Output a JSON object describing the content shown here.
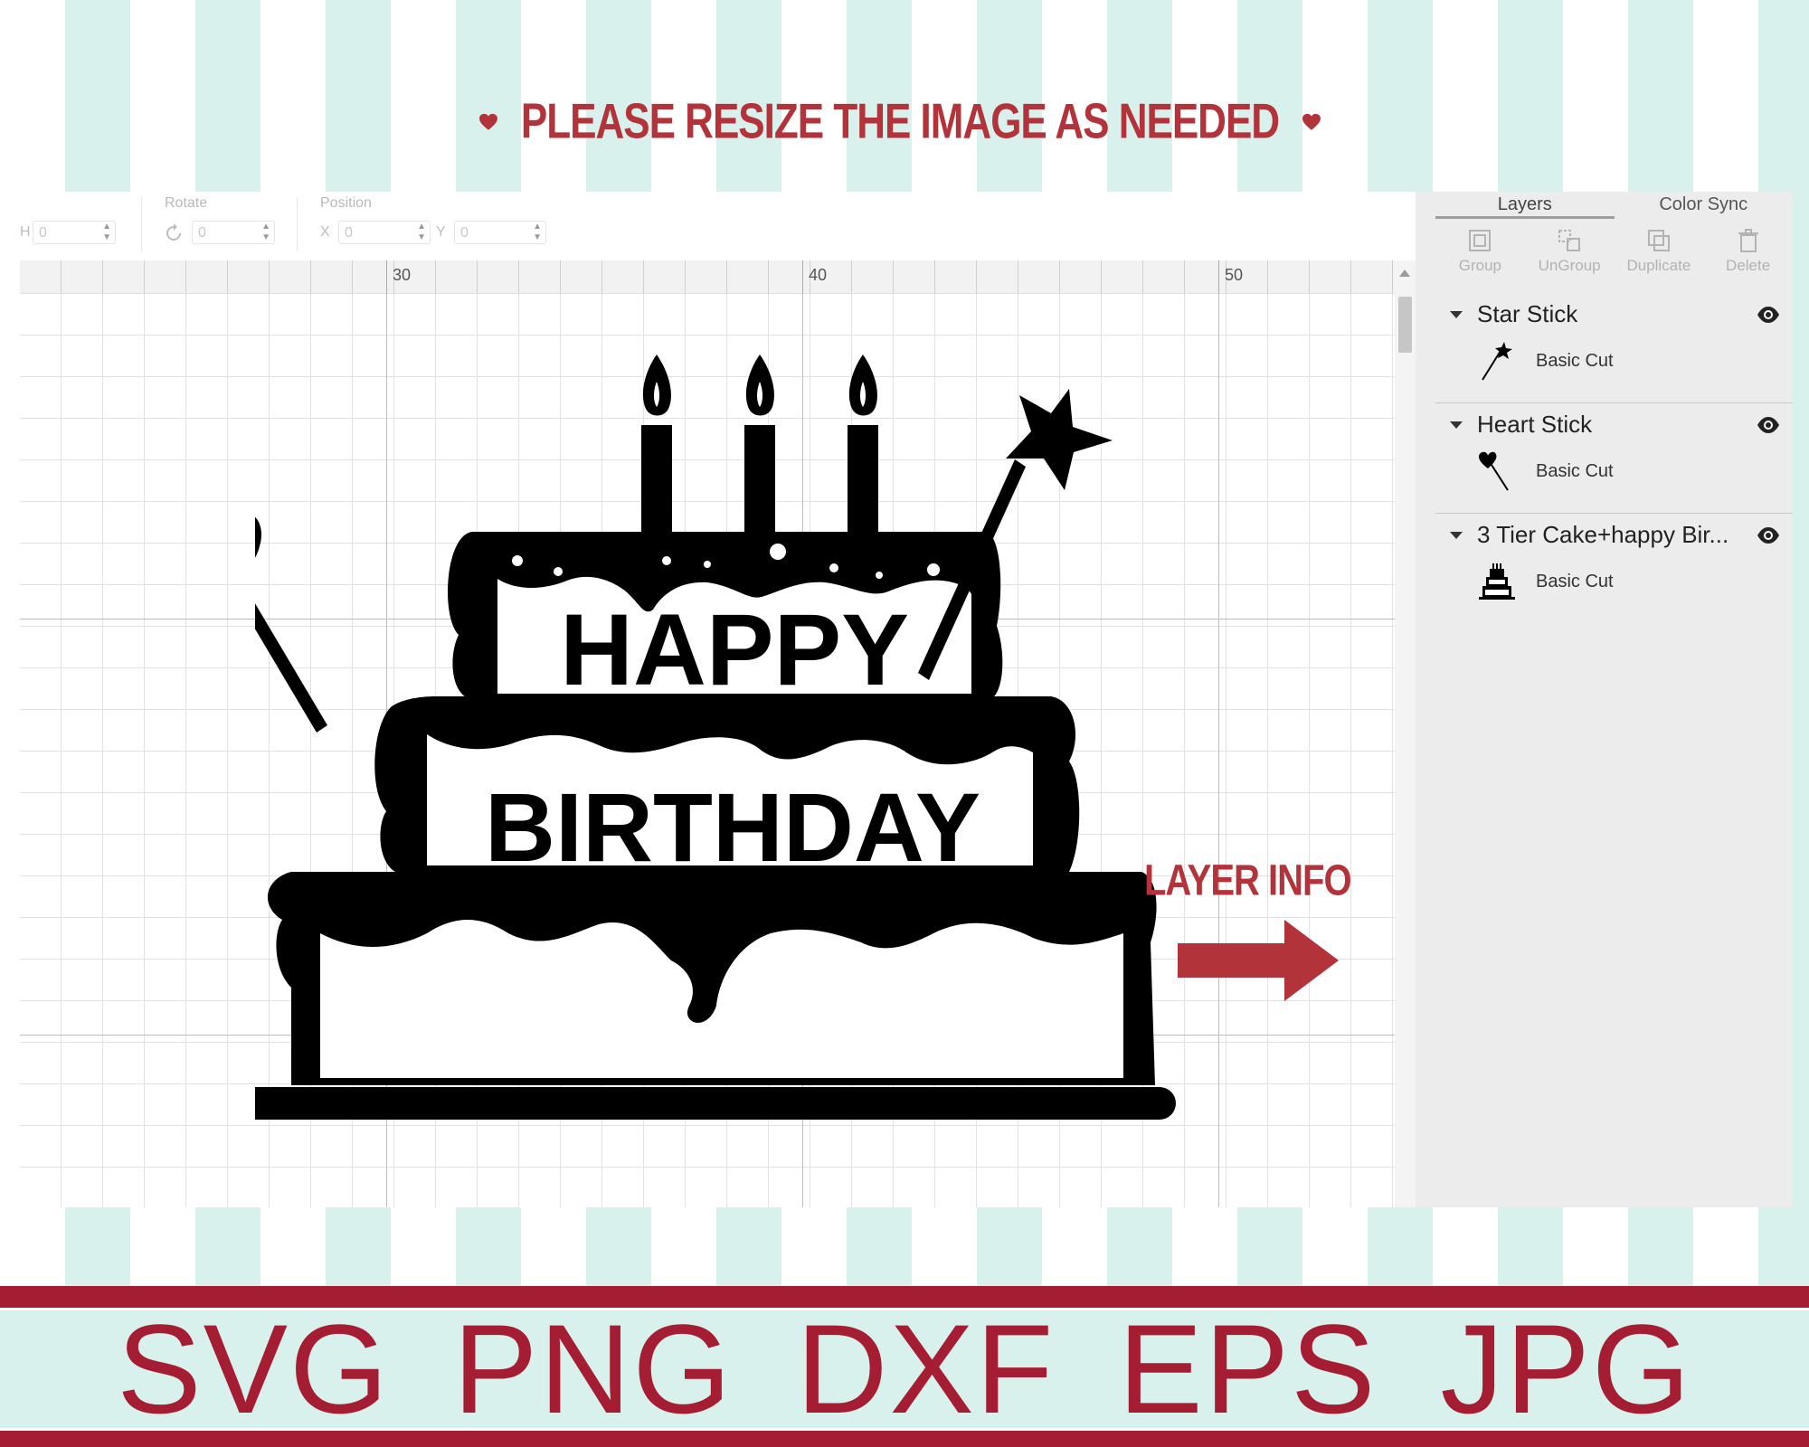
{
  "banner": {
    "message": "PLEASE RESIZE THE IMAGE AS NEEDED"
  },
  "toolbar": {
    "size_axis": "H",
    "size_value": "0",
    "rotate_label": "Rotate",
    "rotate_value": "0",
    "position_label": "Position",
    "x_label": "X",
    "x_value": "0",
    "y_label": "Y",
    "y_value": "0"
  },
  "ruler": {
    "marks": [
      "30",
      "40",
      "50"
    ]
  },
  "artwork": {
    "line1": "HAPPY",
    "line2": "BIRTHDAY"
  },
  "callout": {
    "label": "LAYER INFO"
  },
  "panel": {
    "tabs": [
      "Layers",
      "Color Sync"
    ],
    "actions": [
      "Group",
      "UnGroup",
      "Duplicate",
      "Delete"
    ],
    "layers": [
      {
        "name": "Star Stick",
        "operation": "Basic Cut",
        "thumb_icon": "star-wand-icon"
      },
      {
        "name": "Heart Stick",
        "operation": "Basic Cut",
        "thumb_icon": "heart-stick-icon"
      },
      {
        "name": "3 Tier Cake+happy Bir...",
        "operation": "Basic Cut",
        "thumb_icon": "cake-icon"
      }
    ]
  },
  "footer": {
    "formats": [
      "SVG",
      "PNG",
      "DXF",
      "EPS",
      "JPG"
    ]
  },
  "colors": {
    "accent_red": "#b2333a",
    "band_red": "#a51d32",
    "mint": "#d9f1ec"
  }
}
